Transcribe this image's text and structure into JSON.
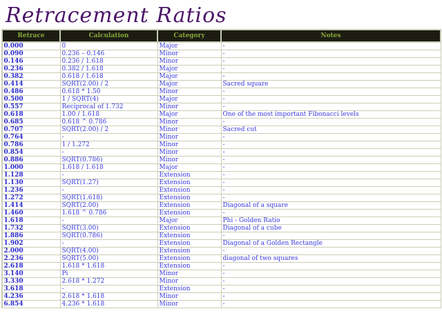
{
  "title": "Retracement Ratios",
  "headers": [
    "Retrace",
    "Calculation",
    "Category",
    "Notes"
  ],
  "rows": [
    [
      "0.000",
      "0",
      "Major",
      "-"
    ],
    [
      "0.090",
      "0.236 – 0.146",
      "Minor",
      "-"
    ],
    [
      "0.146",
      "0.236 / 1.618",
      "Minor",
      "-"
    ],
    [
      "0.236",
      "0.382 / 1.618",
      "Major",
      "-"
    ],
    [
      "0.382",
      "0.618 / 1.618",
      "Major",
      "-"
    ],
    [
      "0.414",
      "SQRT(2.00) / 2",
      "Major",
      "Sacred square"
    ],
    [
      "0.486",
      "0.618 * 1.50",
      "Minor",
      "-"
    ],
    [
      "0.500",
      "1 / SQRT(4)",
      "Major",
      "-"
    ],
    [
      "0.557",
      "Reciprocal of 1.732",
      "Minor",
      "-"
    ],
    [
      "0.618",
      "1.00 / 1.618",
      "Major",
      "One of the most important Fibonacci levels"
    ],
    [
      "0.685",
      "0.618 ^ 0.786",
      "Minor",
      "-"
    ],
    [
      "0.707",
      "SQRT(2.00) / 2",
      "Minor",
      "Sacred cut"
    ],
    [
      "0.764",
      "-",
      "Minor",
      "-"
    ],
    [
      "0.786",
      "1 / 1.272",
      "Minor",
      "-"
    ],
    [
      "0.854",
      "-",
      "Minor",
      "-"
    ],
    [
      "0.886",
      "SQRT(0.786)",
      "Minor",
      "-"
    ],
    [
      "1.000",
      "1.618 / 1.618",
      "Major",
      "-"
    ],
    [
      "1.128",
      "-",
      "Extension",
      "-"
    ],
    [
      "1.130",
      "SQRT(1.27)",
      "Extension",
      "-"
    ],
    [
      "1.236",
      "-",
      "Extension",
      "-"
    ],
    [
      "1.272",
      "SQRT(1.618)",
      "Extension",
      "-"
    ],
    [
      "1.414",
      "SQRT(2.00)",
      "Extension",
      "Diagonal of a square"
    ],
    [
      "1.460",
      "1.618 ^ 0.786",
      "Extension",
      "-"
    ],
    [
      "1.618",
      "-",
      "Major",
      "Phi - Golden Ratio"
    ],
    [
      "1.732",
      "SQRT(3.00)",
      "Extension",
      "Diagonal of a cube"
    ],
    [
      "1.886",
      "SQRT(0.786)",
      "Extension",
      "-"
    ],
    [
      "1.902",
      "-",
      "Extension",
      "Diagonal of a Golden Rectangle"
    ],
    [
      "2.000",
      "SQRT(4.00)",
      "Extension",
      "-"
    ],
    [
      "2.236",
      "SQRT(5.00)",
      "Extension",
      "diagonal of two squares"
    ],
    [
      "2.618",
      "1.618 * 1.618",
      "Extension",
      "-"
    ],
    [
      "3.140",
      "Pi",
      "Minor",
      "-"
    ],
    [
      "3.330",
      "2.618 * 1.272",
      "Minor",
      "-"
    ],
    [
      "3.618",
      "-",
      "Extension",
      "-"
    ],
    [
      "4.236",
      "2.618 * 1.618",
      "Minor",
      "-"
    ],
    [
      "6.854",
      "4.236 * 1.618",
      "Minor",
      "-"
    ]
  ]
}
